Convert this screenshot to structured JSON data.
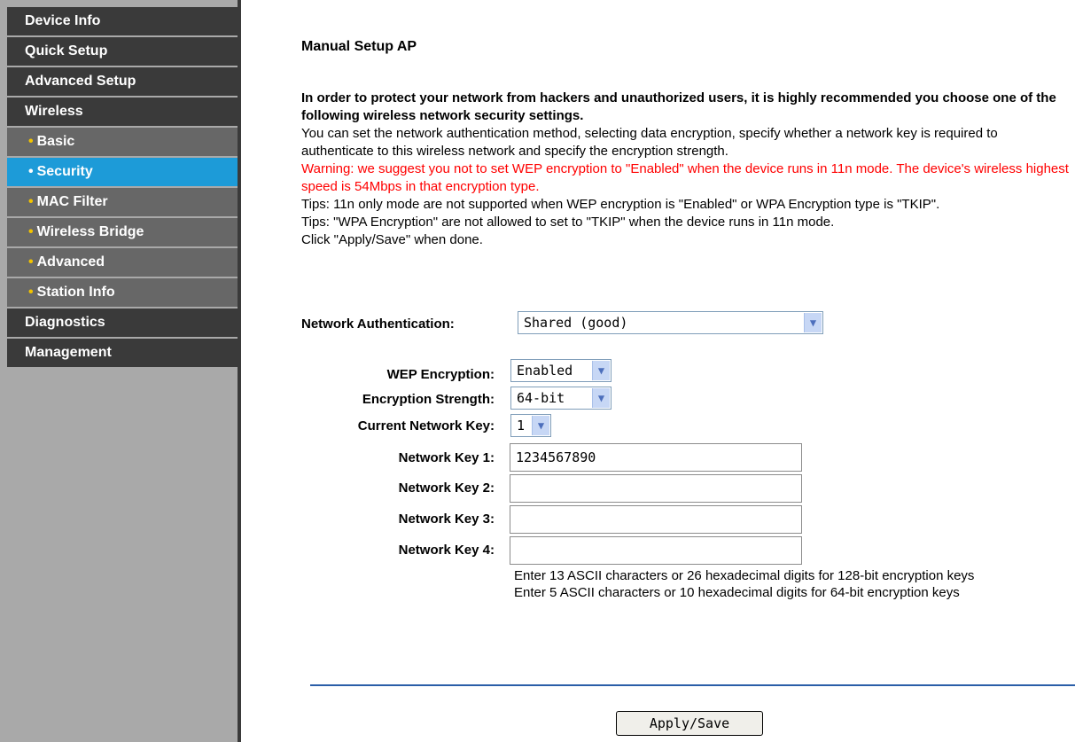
{
  "sidebar": {
    "items": [
      {
        "label": "Device Info",
        "type": "top"
      },
      {
        "label": "Quick Setup",
        "type": "top"
      },
      {
        "label": "Advanced Setup",
        "type": "top"
      },
      {
        "label": "Wireless",
        "type": "top"
      },
      {
        "label": "Basic",
        "type": "sub"
      },
      {
        "label": "Security",
        "type": "sub",
        "active": true
      },
      {
        "label": "MAC Filter",
        "type": "sub"
      },
      {
        "label": "Wireless Bridge",
        "type": "sub"
      },
      {
        "label": "Advanced",
        "type": "sub"
      },
      {
        "label": "Station Info",
        "type": "sub"
      },
      {
        "label": "Diagnostics",
        "type": "top"
      },
      {
        "label": "Management",
        "type": "top"
      }
    ],
    "bullet": "•"
  },
  "main": {
    "title": "Manual Setup AP",
    "intro_bold": "In order to protect your network from hackers and unauthorized users, it is highly recommended you choose one of the following wireless network security settings.",
    "intro_text": "You can set the network authentication method, selecting data encryption, specify whether a network key is required to authenticate to this wireless network and specify the encryption strength.",
    "warning": "Warning: we suggest you not to set WEP encryption to \"Enabled\" when the device runs in 11n mode. The device's wireless highest speed is 54Mbps in that encryption type.",
    "tip1": "Tips: 11n only mode are not supported when WEP encryption is \"Enabled\" or WPA Encryption type is \"TKIP\".",
    "tip2": "Tips: \"WPA Encryption\" are not allowed to set to \"TKIP\" when the device runs in 11n mode.",
    "click_note": "Click \"Apply/Save\" when done."
  },
  "form": {
    "network_auth_label": "Network Authentication:",
    "network_auth_value": "Shared (good)",
    "wep_label": "WEP Encryption:",
    "wep_value": "Enabled",
    "strength_label": "Encryption Strength:",
    "strength_value": "64-bit",
    "current_key_label": "Current Network Key:",
    "current_key_value": "1",
    "key1_label": "Network Key 1:",
    "key1_value": "1234567890",
    "key2_label": "Network Key 2:",
    "key2_value": "",
    "key3_label": "Network Key 3:",
    "key3_value": "",
    "key4_label": "Network Key 4:",
    "key4_value": "",
    "hint_128": "Enter 13 ASCII characters or 26 hexadecimal digits for 128-bit encryption keys",
    "hint_64": "Enter 5 ASCII characters or 10 hexadecimal digits for 64-bit encryption keys",
    "apply_label": "Apply/Save"
  },
  "colors": {
    "sidebar_bg": "#a9a9a9",
    "nav_dark": "#3a3a3a",
    "nav_sub": "#676767",
    "nav_active": "#1d9bd8",
    "bullet": "#f2c300",
    "warning": "#ff0000",
    "divider": "#2a5ea8"
  },
  "icons": {
    "dropdown": "chevron-down-icon"
  }
}
